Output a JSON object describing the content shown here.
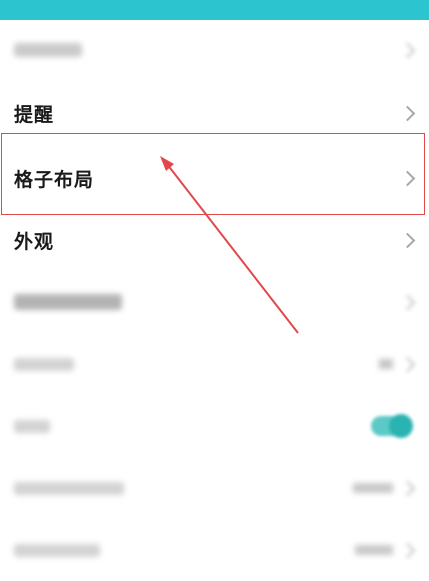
{
  "colors": {
    "header_bar": "#2cc4cf",
    "highlight": "#e0484c",
    "toggle_on": "#2ab3b1"
  },
  "settings": {
    "rows": [
      {
        "label": "",
        "type": "nav",
        "blurred": true
      },
      {
        "label": "提醒",
        "type": "nav",
        "blurred": false
      },
      {
        "label": "格子布局",
        "type": "nav",
        "blurred": false,
        "highlighted": true
      },
      {
        "label": "外观",
        "type": "nav",
        "blurred": false
      },
      {
        "label": "",
        "type": "nav",
        "blurred": true
      },
      {
        "label": "",
        "type": "value",
        "blurred": true
      },
      {
        "label": "",
        "type": "toggle",
        "blurred": true,
        "toggle_state": "on"
      },
      {
        "label": "",
        "type": "value",
        "blurred": true
      },
      {
        "label": "",
        "type": "value",
        "blurred": true
      }
    ]
  }
}
